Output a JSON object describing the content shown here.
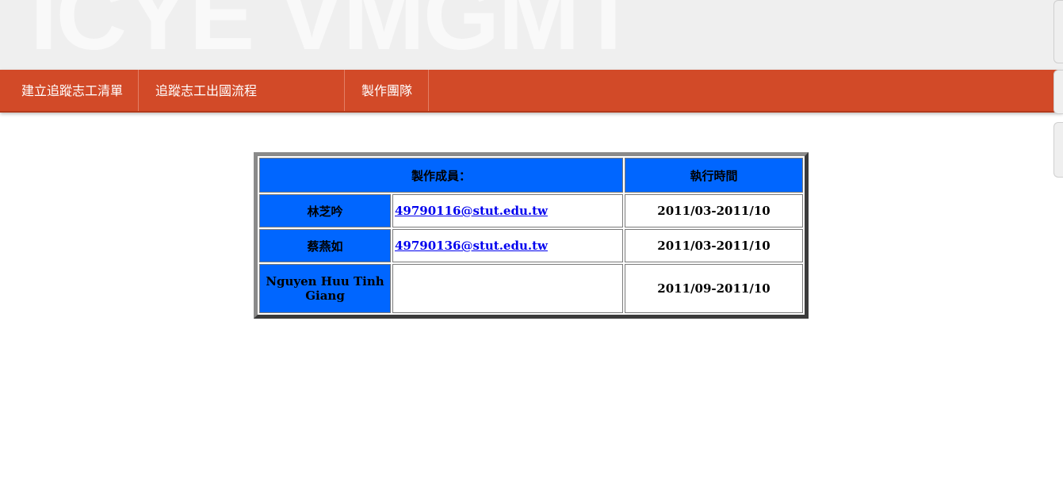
{
  "header": {
    "logo_text": "ICYE VMGMT"
  },
  "nav": {
    "items": [
      {
        "label": "建立追蹤志工清單"
      },
      {
        "label": "追蹤志工出國流程"
      },
      {
        "label": "製作團隊"
      }
    ]
  },
  "team_table": {
    "header_members": "製作成員：",
    "header_time": "執行時間",
    "rows": [
      {
        "name": "林芝吟",
        "email": "49790116@stut.edu.tw",
        "period": "2011/03-2011/10"
      },
      {
        "name": "蔡燕如",
        "email": "49790136@stut.edu.tw",
        "period": "2011/03-2011/10"
      },
      {
        "name": "Nguyen Huu Tinh Giang",
        "email": "",
        "period": "2011/09-2011/10"
      }
    ]
  },
  "colors": {
    "nav_background": "#d24a28",
    "header_background": "#efefef",
    "table_header_blue": "#0066ff",
    "link": "#0000ee"
  }
}
